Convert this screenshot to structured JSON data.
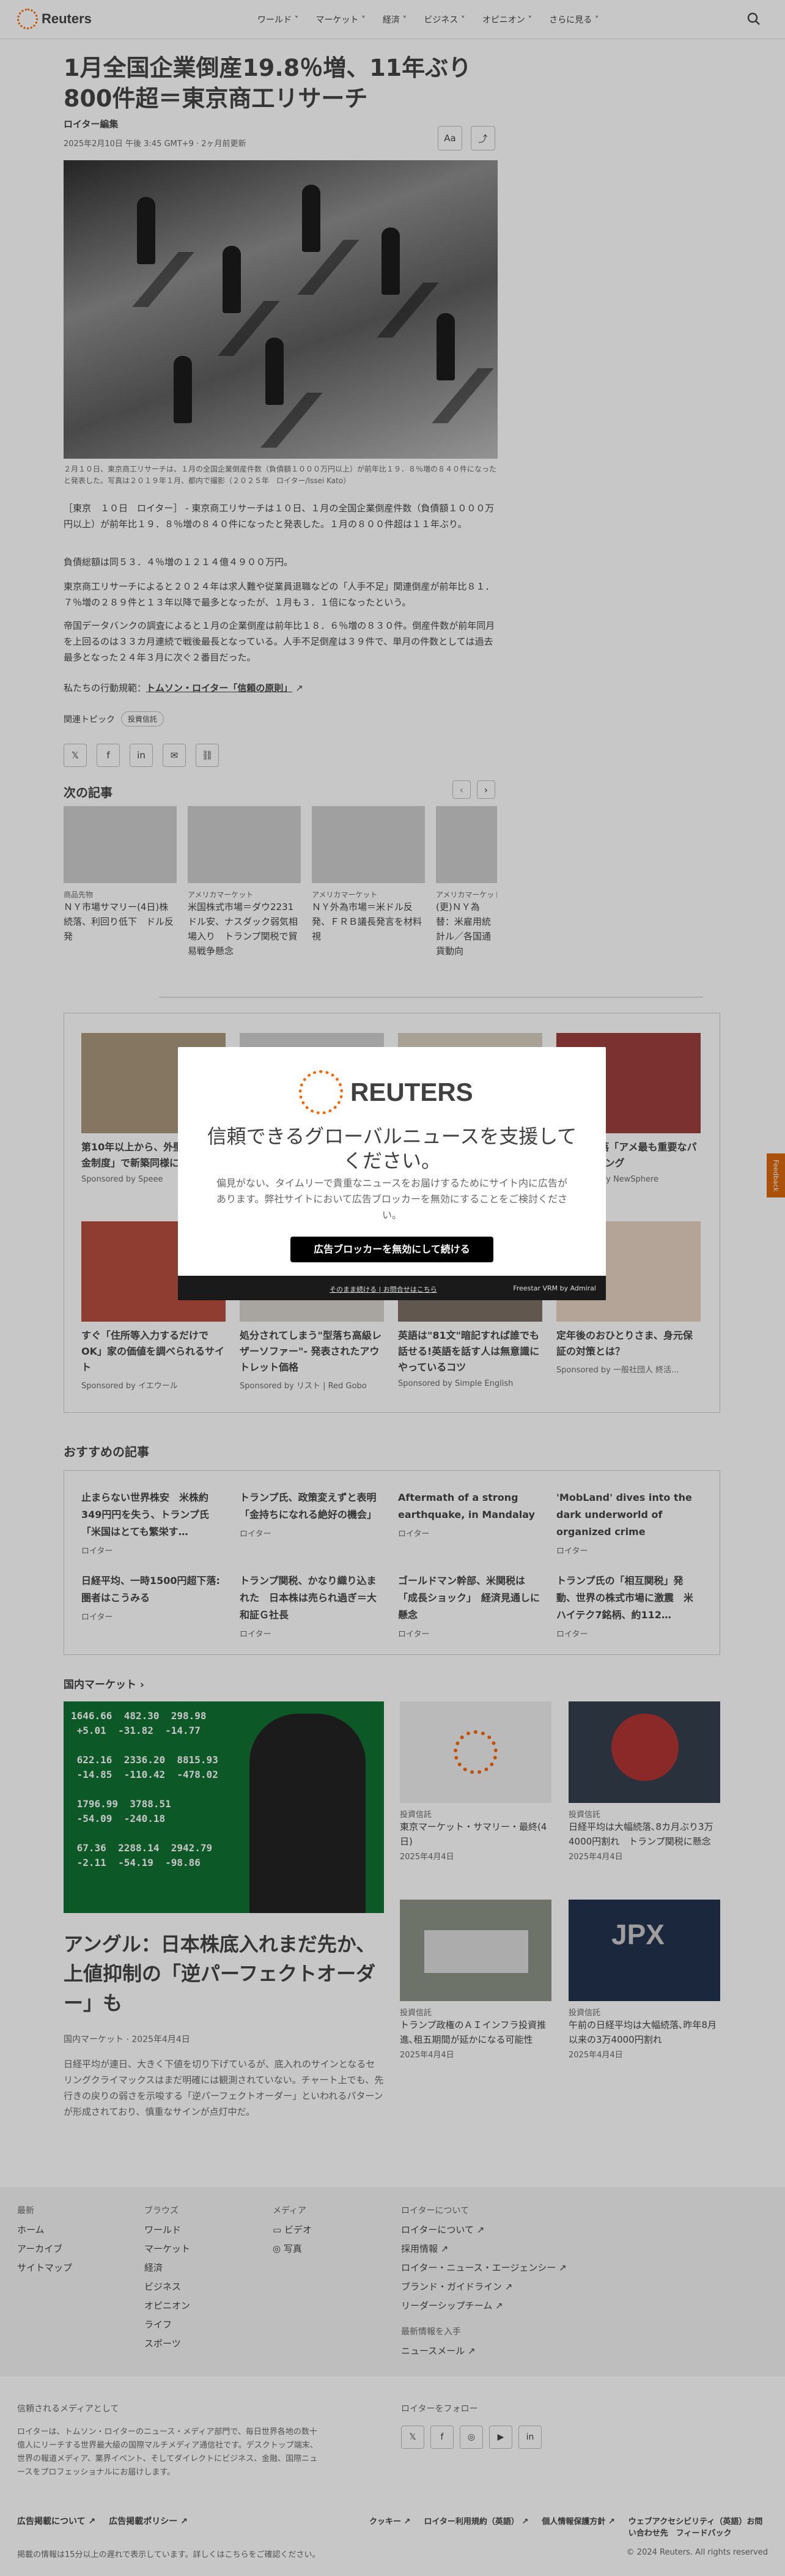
{
  "header": {
    "logo_text": "Reuters",
    "nav": [
      "ワールド",
      "マーケット",
      "経済",
      "ビジネス",
      "オピニオン",
      "さらに見る"
    ],
    "search_icon": "search-icon"
  },
  "article": {
    "title": "1月全国企業倒産19.8％増、11年ぶり800件超＝東京商工リサーチ",
    "byline": "ロイター編集",
    "dateline": "2025年2月10日 午後 3:45 GMT+9 · 2ヶ月前更新",
    "text_size_label": "Aa",
    "caption": "２月１０日、東京商工リサーチは、１月の全国企業倒産件数（負債額１０００万円以上）が前年比１９．８％増の８４０件になったと発表した。写真は２０１９年１月、都内で撮影（２０２５年　ロイター/Issei Kato）",
    "paragraphs": [
      "［東京　１０日　ロイター］ - 東京商工リサーチは１０日、１月の全国企業倒産件数（負債額１０００万円以上）が前年比１９．８％増の８４０件になったと発表した。１月の８００件超は１１年ぶり。",
      "負債総額は同５３．４％増の１２１４億４９００万円。",
      "東京商工リサーチによると２０２４年は求人難や従業員退職などの「人手不足」関連倒産が前年比８１．７％増の２８９件と１３年以降で最多となったが、１月も３．１倍になったという。",
      "帝国データバンクの調査によると１月の企業倒産は前年比１８．６％増の８３０件。倒産件数が前年同月を上回るのは３３カ月連続で戦後最長となっている。人手不足倒産は３９件で、単月の件数としては過去最多となった２４年３月に次ぐ２番目だった。"
    ],
    "principles_prefix": "私たちの行動規範：",
    "principles_link": "トムソン・ロイター「信頼の原則」",
    "topics_label": "関連トピック",
    "topic": "投資信託"
  },
  "share_icons": [
    "x-icon",
    "facebook-icon",
    "linkedin-icon",
    "email-icon",
    "link-icon"
  ],
  "next": {
    "title": "次の記事",
    "items": [
      {
        "cat": "商品先物",
        "hd": "ＮＹ市場サマリー(4日)株続落、利回り低下　ドル反発"
      },
      {
        "cat": "アメリカマーケット",
        "hd": "米国株式市場＝ダウ2231ドル安、ナスダック弱気相場入り　トランプ関税で貿易戦争懸念"
      },
      {
        "cat": "アメリカマーケット",
        "hd": "ＮＹ外為市場＝米ドル反発、ＦＲＢ議長発言を材料視"
      },
      {
        "cat": "アメリカマーケット",
        "hd": "(更)ＮＹ為替：米雇用統計ル／各国通貨動向"
      }
    ]
  },
  "ads": [
    {
      "hd": "第10年以上から、外壁の「助成金制度」で新築同様に",
      "sp": "Sponsored by Speee"
    },
    {
      "hd": "",
      "sp": ""
    },
    {
      "hd": "",
      "sp": ""
    },
    {
      "hd": "33%へ急落「アメ最も重要なパートランキング",
      "sp": "Sponsored by NewSphere"
    },
    {
      "hd": "すぐ「住所等入力するだけでOK」家の価値を調べられるサイト",
      "sp": "Sponsored by イエウール"
    },
    {
      "hd": "処分されてしまう\"型落ち高級レザーソファー\"- 発表されたアウトレット価格",
      "sp": "Sponsored by リスト | Red Gobo"
    },
    {
      "hd": "英語は\"81文\"暗記すれば誰でも話せる!英語を話す人は無意識にやっているコツ",
      "sp": "Sponsored by Simple English"
    },
    {
      "hd": "定年後のおひとりさま、身元保証の対策とは？",
      "sp": "Sponsored by 一般社団人 終活..."
    }
  ],
  "modal": {
    "logo_text": "REUTERS",
    "headline": "信頼できるグローバルニュースを支援してください。",
    "desc": "偏見がない、タイムリーで貴重なニュースをお届けするためにサイト内に広告があります。弊社サイトにおいて広告ブロッカーを無効にすることをご検討ください。",
    "cta": "広告ブロッカーを無効にして続ける",
    "footer_link": "そのまま続ける | お問合せはこちら",
    "footer_brand": "Freestar VRM by Admiral"
  },
  "recommended": {
    "title": "おすすめの記事",
    "items": [
      {
        "hd": "止まらない世界株安　米株約349円円を失う、トランプ氏「米国はとても繁栄す…",
        "src": "ロイター"
      },
      {
        "hd": "トランプ氏、政策変えずと表明「金持ちになれる絶好の機会」",
        "src": "ロイター"
      },
      {
        "hd": "Aftermath of a strong earthquake, in Mandalay",
        "src": "ロイター"
      },
      {
        "hd": "'MobLand' dives into the dark underworld of organized crime",
        "src": "ロイター"
      },
      {
        "hd": "日経平均、一時1500円超下落:圏者はこうみる",
        "src": "ロイター"
      },
      {
        "hd": "トランプ関税、かなり織り込まれた　日本株は売られ過ぎ＝大和証Ｇ社長",
        "src": "ロイター"
      },
      {
        "hd": "ゴールドマン幹部、米関税は「成長ショック」　経済見通しに懸念",
        "src": "ロイター"
      },
      {
        "hd": "トランプ氏の「相互関税」発動、世界の株式市場に激震　米ハイテク7銘柄、約112…",
        "src": "ロイター"
      }
    ]
  },
  "domestic": {
    "title": "国内マーケット",
    "main_hd": "アングル：日本株底入れまだ先か、上値抑制の「逆パーフェクトオーダー」も",
    "main_dt": "国内マーケット · 2025年4月4日",
    "main_p": "日経平均が連日、大きく下値を切り下げているが、底入れのサインとなるセリングクライマックスはまだ明確には観測されていない。チャート上でも、先行きの戻りの弱さを示唆する「逆パーフェクトオーダー」といわれるパターンが形成されており、慎重なサインが点灯中だ。",
    "board_text": "1646.66  482.30  298.98\n +5.01  -31.82  -14.77\n\n 622.16  2336.20  8815.93\n -14.85  -110.42  -478.02\n\n 1796.99  3788.51\n -54.09  -240.18\n\n 67.36  2288.14  2942.79\n -2.11  -54.19  -98.86",
    "cards": [
      {
        "cat": "投資信託",
        "hd": "東京マーケット・サマリー・最終(4日)",
        "dt": "2025年4月4日"
      },
      {
        "cat": "投資信託",
        "hd": "日経平均は大幅続落､8カ月ぶり3万4000円割れ　トランプ関税に懸念",
        "dt": "2025年4月4日"
      },
      {
        "cat": "投資信託",
        "hd": "トランプ政権のＡＩインフラ投資推進､租五期間が延かになる可能性",
        "dt": "2025年4月4日"
      },
      {
        "cat": "投資信託",
        "hd": "午前の日経平均は大幅続落､昨年8月以来の3万4000円割れ",
        "dt": "2025年4月4日"
      }
    ]
  },
  "footer": {
    "cols": [
      {
        "h": "最新",
        "items": [
          "ホーム",
          "アーカイブ",
          "サイトマップ"
        ]
      },
      {
        "h": "ブラウズ",
        "items": [
          "ワールド",
          "マーケット",
          "経済",
          "ビジネス",
          "オピニオン",
          "ライフ",
          "スポーツ"
        ]
      },
      {
        "h": "メディア",
        "items": [
          "ビデオ",
          "写真"
        ]
      },
      {
        "h": "ロイターについて",
        "items": [
          "ロイターについて",
          "採用情報",
          "ロイター・ニュース・エージェンシー",
          "ブランド・ガイドライン",
          "リーダーシップチーム"
        ]
      }
    ],
    "newsletter_h": "最新情報を入手",
    "newsletter": "ニュースメール",
    "trusted_h": "信頼されるメディアとして",
    "trusted_p": "ロイターは、トムソン・ロイターのニュース・メディア部門で、毎日世界各地の数十億人にリーチする世界最大級の国際マルチメディア通信社です。デスクトップ端末、世界の報道メディア、業界イベント、そしてダイレクトにビジネス、金融、国際ニュースをプロフェッショナルにお届けします。",
    "follow_h": "ロイターをフォロー",
    "bottom_links": [
      "広告掲載について",
      "広告掲載ポリシー",
      "クッキー",
      "ロイター利用規約（英語）",
      "個人情報保護方針",
      "ウェブアクセシビリティ（英語）お問い合わせ先　フィードバック"
    ],
    "note": "掲載の情報は15分以上の遅れで表示しています。詳しくはこちらをご確認ください。",
    "copyright": "© 2024 Reuters. All rights reserved"
  },
  "feedback_label": "Feedback"
}
